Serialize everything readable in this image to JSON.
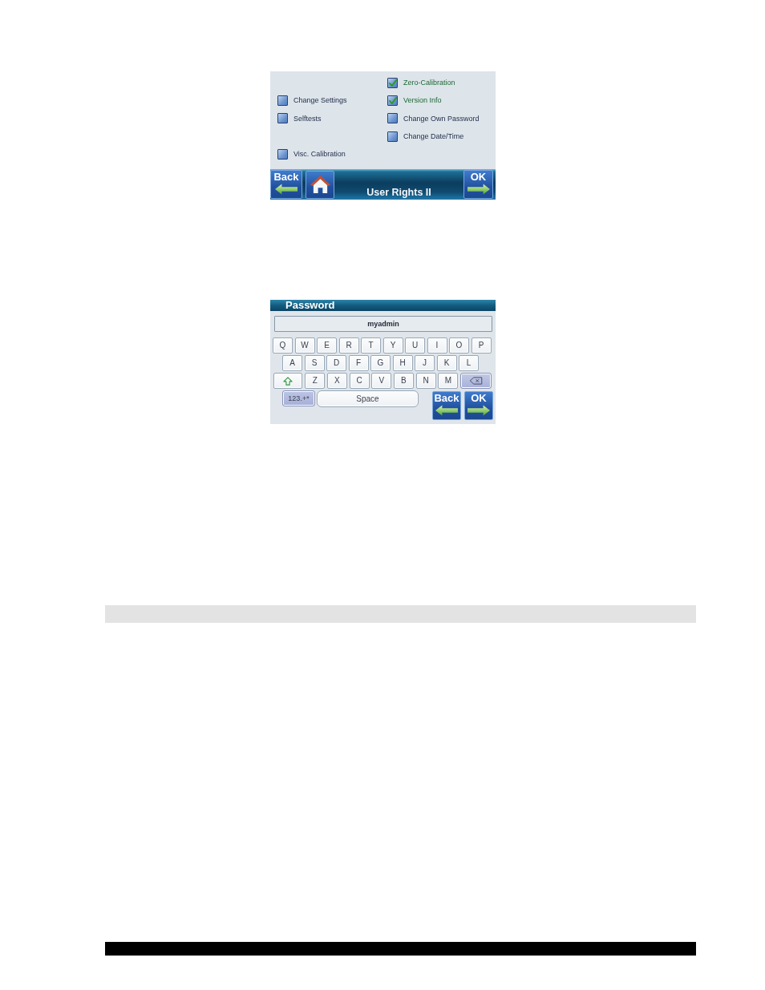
{
  "user_rights_screen": {
    "rows": [
      {
        "right": {
          "label": "Zero-Calibration",
          "checked": true
        }
      },
      {
        "left": {
          "label": "Change Settings",
          "checked": false
        },
        "right": {
          "label": "Version Info",
          "checked": true
        }
      },
      {
        "left": {
          "label": "Selftests",
          "checked": false
        },
        "right": {
          "label": "Change Own Password",
          "checked": false
        }
      },
      {
        "right": {
          "label": "Change Date/Time",
          "checked": false
        }
      },
      {
        "left": {
          "label": "Visc. Calibration",
          "checked": false
        }
      }
    ],
    "back_button": {
      "label": "Back"
    },
    "title": "User Rights II",
    "ok_button": {
      "label": "OK"
    }
  },
  "password_screen": {
    "title": "Password",
    "field": {
      "value": "myadmin"
    },
    "key_rows": [
      [
        {
          "kind": "char",
          "label": "Q"
        },
        {
          "kind": "char",
          "label": "W"
        },
        {
          "kind": "char",
          "label": "E"
        },
        {
          "kind": "char",
          "label": "R"
        },
        {
          "kind": "char",
          "label": "T"
        },
        {
          "kind": "char",
          "label": "Y"
        },
        {
          "kind": "char",
          "label": "U"
        },
        {
          "kind": "char",
          "label": "I"
        },
        {
          "kind": "char",
          "label": "O"
        },
        {
          "kind": "char",
          "label": "P"
        }
      ],
      [
        {
          "kind": "char",
          "label": "A"
        },
        {
          "kind": "char",
          "label": "S"
        },
        {
          "kind": "char",
          "label": "D"
        },
        {
          "kind": "char",
          "label": "F"
        },
        {
          "kind": "char",
          "label": "G"
        },
        {
          "kind": "char",
          "label": "H"
        },
        {
          "kind": "char",
          "label": "J"
        },
        {
          "kind": "char",
          "label": "K"
        },
        {
          "kind": "char",
          "label": "L"
        }
      ],
      [
        {
          "kind": "shift"
        },
        {
          "kind": "char",
          "label": "Z"
        },
        {
          "kind": "char",
          "label": "X"
        },
        {
          "kind": "char",
          "label": "C"
        },
        {
          "kind": "char",
          "label": "V"
        },
        {
          "kind": "char",
          "label": "B"
        },
        {
          "kind": "char",
          "label": "N"
        },
        {
          "kind": "char",
          "label": "M"
        },
        {
          "kind": "backspace"
        }
      ]
    ],
    "mode_key": {
      "label": "123.+*"
    },
    "space_key": {
      "label": "Space"
    },
    "back_button": {
      "label": "Back"
    },
    "ok_button": {
      "label": "OK"
    }
  }
}
